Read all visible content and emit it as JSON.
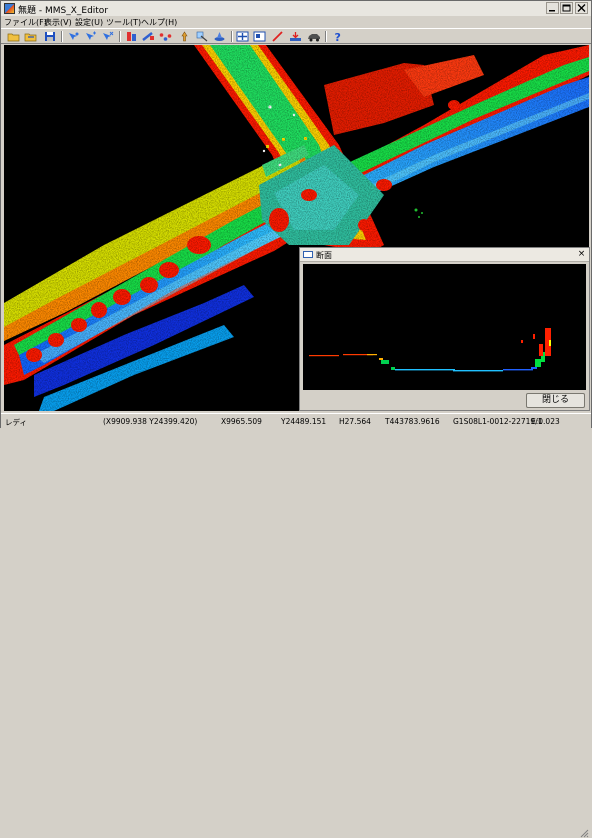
{
  "window": {
    "title": "無題 - MMS_X_Editor",
    "minimize_icon": "minimize-icon",
    "maximize_icon": "maximize-icon",
    "close_icon": "close-icon"
  },
  "menu": [
    "ファイル(F)",
    "表示(V)",
    "設定(U)",
    "ツール(T)",
    "ヘルプ(H)"
  ],
  "toolbar": {
    "icons": [
      "open-folder-icon",
      "open-file-icon",
      "save-icon",
      "select-tool-icon",
      "move-tool-icon",
      "rotate-tool-icon",
      "edit-points-icon",
      "delete-points-icon",
      "link-points-icon",
      "pin-icon",
      "measure-icon",
      "layer-icon",
      "add-view-icon",
      "section-view-icon",
      "draw-line-icon",
      "export-icon",
      "car-icon",
      "help-icon"
    ]
  },
  "status": {
    "ready": "レディ",
    "center": "(X9909.938 Y24399.420)",
    "x": "X9965.509",
    "y": "Y24489.151",
    "h": "H27.564",
    "t": "T443783.9616",
    "file": "G1S08L1-0012-22719/1",
    "e": "E:0.023"
  },
  "section_dialog": {
    "title": "断面",
    "close_label": "×",
    "close_button_label": "閉じる"
  },
  "colors": {
    "point_high": "#ff0000",
    "point_mid": "#00ff40",
    "point_low": "#1040ff",
    "road": "#2a9cff",
    "background": "#000000"
  }
}
